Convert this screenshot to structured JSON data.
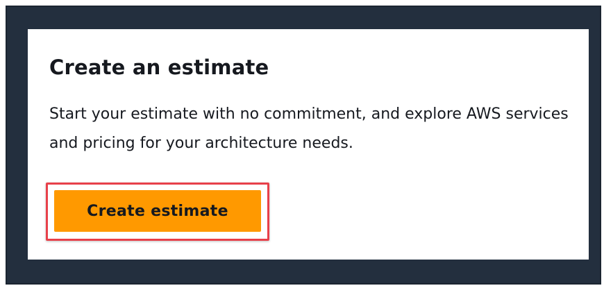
{
  "card": {
    "title": "Create an estimate",
    "description": "Start your estimate with no commitment, and explore AWS services and pricing for your architecture needs.",
    "button_label": "Create estimate"
  },
  "colors": {
    "frame_background": "#232f3e",
    "card_background": "#ffffff",
    "button_background": "#ff9900",
    "highlight_border": "#e8404a",
    "text": "#16191f"
  }
}
